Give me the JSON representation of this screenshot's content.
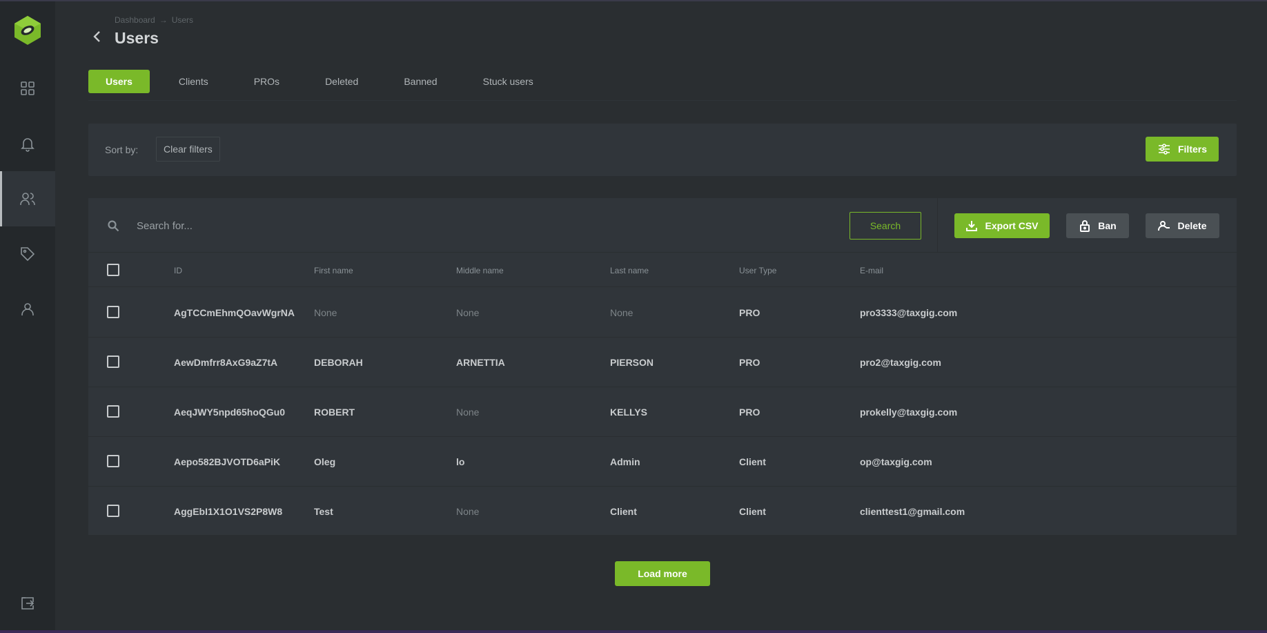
{
  "breadcrumb": {
    "root": "Dashboard",
    "separator": "→",
    "current": "Users"
  },
  "page": {
    "title": "Users"
  },
  "tabs": [
    {
      "label": "Users",
      "active": true
    },
    {
      "label": "Clients",
      "active": false
    },
    {
      "label": "PROs",
      "active": false
    },
    {
      "label": "Deleted",
      "active": false
    },
    {
      "label": "Banned",
      "active": false
    },
    {
      "label": "Stuck users",
      "active": false
    }
  ],
  "filters": {
    "sort_label": "Sort by:",
    "clear_label": "Clear filters",
    "filters_label": "Filters"
  },
  "search": {
    "placeholder": "Search for...",
    "value": "",
    "button_label": "Search"
  },
  "actions": {
    "export_label": "Export CSV",
    "ban_label": "Ban",
    "delete_label": "Delete"
  },
  "table": {
    "columns": [
      "ID",
      "First name",
      "Middle name",
      "Last name",
      "User Type",
      "E-mail"
    ],
    "rows": [
      {
        "id": "AgTCCmEhmQOavWgrNA",
        "first": "None",
        "middle": "None",
        "last": "None",
        "type": "PRO",
        "email": "pro3333@taxgig.com"
      },
      {
        "id": "AewDmfrr8AxG9aZ7tA",
        "first": "DEBORAH",
        "middle": "ARNETTIA",
        "last": "PIERSON",
        "type": "PRO",
        "email": "pro2@taxgig.com"
      },
      {
        "id": "AeqJWY5npd65hoQGu0",
        "first": "ROBERT",
        "middle": "None",
        "last": "KELLYS",
        "type": "PRO",
        "email": "prokelly@taxgig.com"
      },
      {
        "id": "Aepo582BJVOTD6aPiK",
        "first": "Oleg",
        "middle": "lo",
        "last": "Admin",
        "type": "Client",
        "email": "op@taxgig.com"
      },
      {
        "id": "AggEbI1X1O1VS2P8W8",
        "first": "Test",
        "middle": "None",
        "last": "Client",
        "type": "Client",
        "email": "clienttest1@gmail.com"
      }
    ]
  },
  "load_more": {
    "label": "Load more"
  },
  "colors": {
    "accent": "#7ab929",
    "background": "#2a2e31",
    "panel": "#30353a",
    "sidebar": "#24282b"
  },
  "icons": {
    "sidebar": [
      "dashboard-grid-icon",
      "bell-icon",
      "users-icon",
      "tag-icon",
      "user-icon",
      "logout-icon"
    ],
    "logo": "leaf-logo-icon"
  }
}
